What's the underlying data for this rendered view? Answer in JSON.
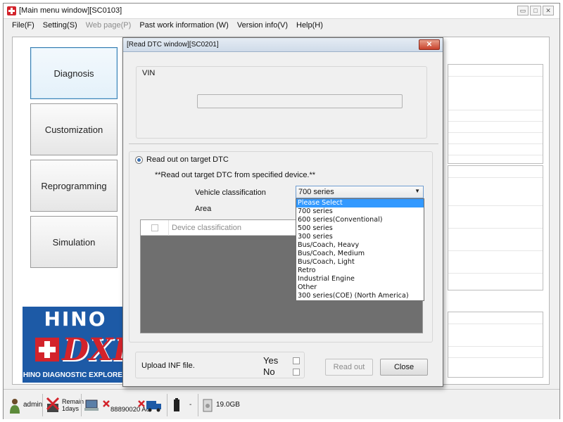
{
  "main_window": {
    "title": "[Main menu window][SC0103]",
    "controls": {
      "minimize": "▭",
      "maximize": "□",
      "close": "✕"
    }
  },
  "menu": [
    {
      "label": "File(F)",
      "enabled": true
    },
    {
      "label": "Setting(S)",
      "enabled": true
    },
    {
      "label": "Web page(P)",
      "enabled": false
    },
    {
      "label": "Past work information (W)",
      "enabled": true
    },
    {
      "label": "Version info(V)",
      "enabled": true
    },
    {
      "label": "Help(H)",
      "enabled": true
    }
  ],
  "nav": {
    "diagnosis": "Diagnosis",
    "customization": "Customization",
    "reprogramming": "Reprogramming",
    "simulation": "Simulation"
  },
  "logo": {
    "top": "HINO",
    "mid": "DXII",
    "bottom": "HINO DIAGNOSTIC EXPLORER"
  },
  "status": {
    "user": "admin",
    "remain": "Remain",
    "remain_days": "1days",
    "device_id": "88890020",
    "device_suffix": "A0",
    "dash": "-",
    "disk": "19.0GB"
  },
  "dialog": {
    "title": "[Read DTC window][SC0201]",
    "close": "✕",
    "vin_label": "VIN",
    "vin_value": "",
    "radio_label": "Read out on target DTC",
    "note": "**Read out target DTC from specified device.**",
    "vehicle_classification_label": "Vehicle classification",
    "area_label": "Area",
    "selected_vehicle": "700 series",
    "table_header": "Device classification",
    "upload_label": "Upload INF file.",
    "yes": "Yes",
    "no": "No",
    "read_out": "Read out",
    "close_button": "Close"
  },
  "dropdown_options": [
    "Please Select",
    "700 series",
    "600 series(Conventional)",
    "500 series",
    "300 series",
    "Bus/Coach, Heavy",
    "Bus/Coach, Medium",
    "Bus/Coach, Light",
    "Retro",
    "Industrial Engine",
    "Other",
    "300 series(COE) (North America)"
  ],
  "highlighted_option_index": 0,
  "colors": {
    "accent_selection": "#3399ff",
    "hino_blue": "#1d5aa6",
    "hino_red": "#d3232b"
  }
}
